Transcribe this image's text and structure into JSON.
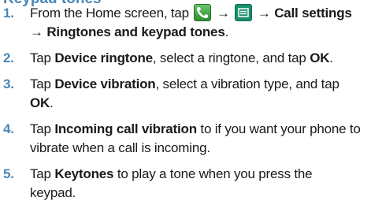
{
  "heading_fragment": "Keypad tones",
  "steps": [
    {
      "number": "1.",
      "t1": "From the Home screen, tap",
      "arrow1": "→",
      "arrow2": "→",
      "call_settings": "Call settings",
      "arrow3": "→",
      "ringtones": "Ringtones and keypad tones",
      "end": ".",
      "phone_icon": "phone-icon",
      "menu_icon": "menu-icon"
    },
    {
      "number": "2.",
      "t1": "Tap",
      "b1": "Device ringtone",
      "t2": ", select a ringtone, and tap",
      "b2": "OK",
      "end": "."
    },
    {
      "number": "3.",
      "t1": "Tap",
      "b1": "Device vibration",
      "t2": ", select a vibration type, and tap",
      "b2": "OK",
      "end": "."
    },
    {
      "number": "4.",
      "t1": "Tap",
      "b1": "Incoming call vibration",
      "t2": "to if you want your phone to",
      "t3": "vibrate when a call is incoming."
    },
    {
      "number": "5.",
      "t1": "Tap",
      "b1": "Keytones",
      "t2": "to play a tone when you press the",
      "t3": "keypad."
    }
  ]
}
